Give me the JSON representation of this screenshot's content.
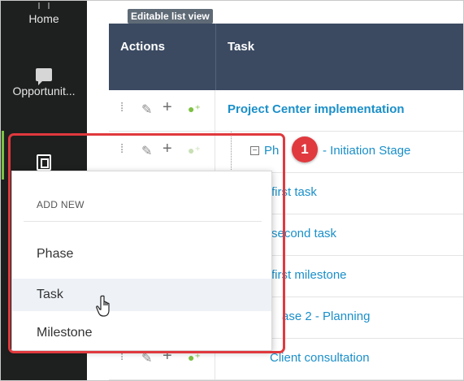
{
  "nav": {
    "home_label": "Home",
    "opportunities_label": "Opportunit..."
  },
  "tooltip": "Editable list view",
  "table": {
    "headers": {
      "actions": "Actions",
      "task": "Task"
    },
    "rows": [
      {
        "task": "Project Center implementation",
        "level": 0
      },
      {
        "task": "Phase 1 - Initiation Stage",
        "level": 1,
        "visible_text": "Ph",
        "visible_tail": "- Initiation Stage"
      },
      {
        "task": "first task",
        "level": 2
      },
      {
        "task": "second task",
        "level": 2
      },
      {
        "task": "first milestone",
        "level": 2
      },
      {
        "task": "ase 2 - Planning",
        "level": 1
      },
      {
        "task": "Client consultation",
        "level": 2
      }
    ]
  },
  "badge": "1",
  "dropdown": {
    "title": "ADD NEW",
    "items": [
      "Phase",
      "Task",
      "Milestone"
    ],
    "hovered": "Task"
  },
  "colors": {
    "nav_bg": "#1e1f1f",
    "header_bg": "#3b4a61",
    "link": "#1a8fc9",
    "accent_green": "#7cc142",
    "highlight_red": "#e0393e"
  }
}
